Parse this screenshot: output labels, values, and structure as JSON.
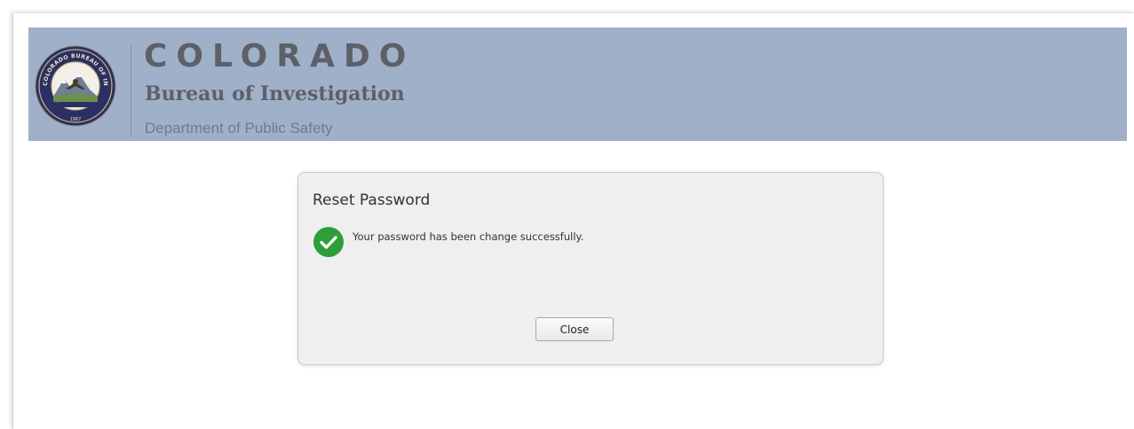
{
  "header": {
    "title": "COLORADO",
    "subtitle": "Bureau of Investigation",
    "department": "Department of Public Safety",
    "seal_text": "COLORADO BUREAU OF INVESTIGATION",
    "seal_year": "1967"
  },
  "dialog": {
    "title": "Reset Password",
    "message": "Your password has been change successfully.",
    "close_label": "Close",
    "success_icon": "check-circle-icon"
  },
  "colors": {
    "banner": "#a0b0c8",
    "success": "#2e9e3a",
    "dialog_background": "#efefef"
  }
}
